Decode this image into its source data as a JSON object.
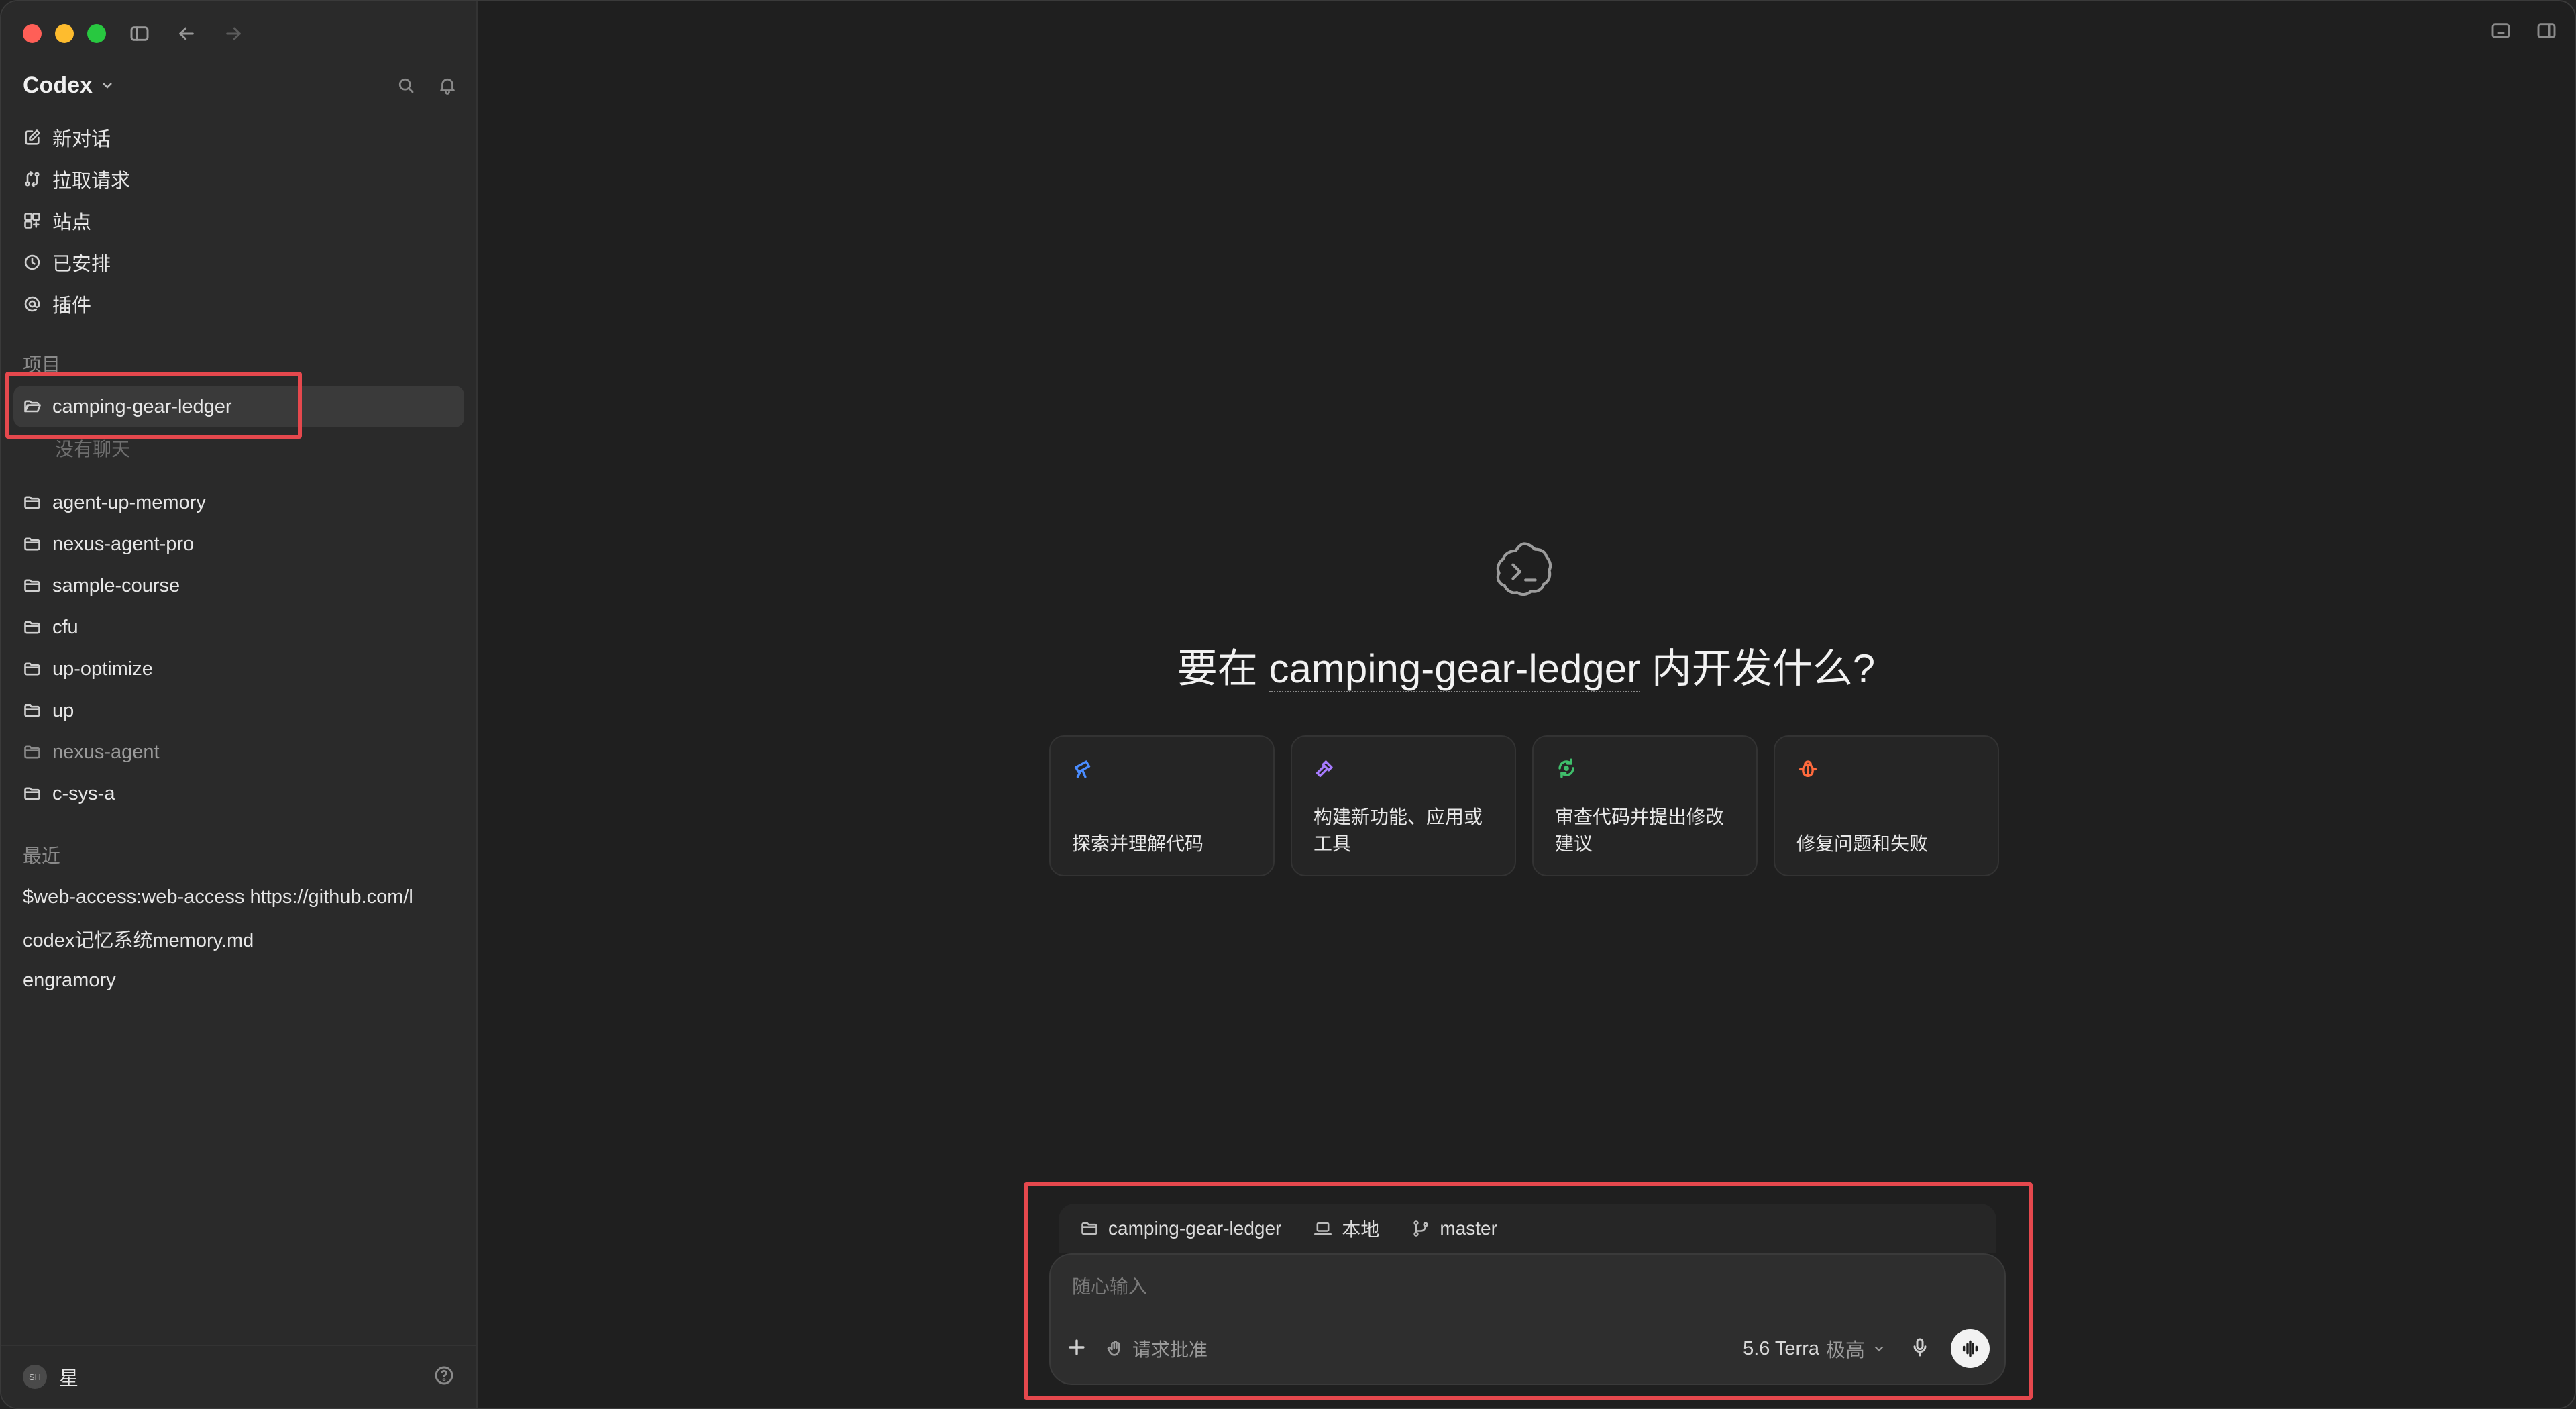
{
  "app": {
    "name": "Codex",
    "user_initials": "SH",
    "user_name": "星"
  },
  "nav": [
    {
      "label": "新对话",
      "icon": "compose-icon"
    },
    {
      "label": "拉取请求",
      "icon": "pull-request-icon"
    },
    {
      "label": "站点",
      "icon": "sites-icon"
    },
    {
      "label": "已安排",
      "icon": "clock-icon"
    },
    {
      "label": "插件",
      "icon": "at-icon"
    }
  ],
  "projects": {
    "heading": "项目",
    "active": "camping-gear-ledger",
    "empty_note": "没有聊天",
    "items": [
      "agent-up-memory",
      "nexus-agent-pro",
      "sample-course",
      "cfu",
      "up-optimize",
      "up",
      "nexus-agent",
      "c-sys-a"
    ]
  },
  "recent": {
    "heading": "最近",
    "items": [
      "$web-access:web-access https://github.com/l",
      "codex记忆系统memory.md",
      "engramory"
    ]
  },
  "main": {
    "headline_prefix": "要在 ",
    "headline_project": "camping-gear-ledger",
    "headline_suffix": " 内开发什么?",
    "cards": [
      {
        "label": "探索并理解代码",
        "icon": "telescope-icon",
        "color": "#4a8cff"
      },
      {
        "label": "构建新功能、应用或工具",
        "icon": "hammer-icon",
        "color": "#a77bff"
      },
      {
        "label": "审查代码并提出修改建议",
        "icon": "review-icon",
        "color": "#3fbf6b"
      },
      {
        "label": "修复问题和失败",
        "icon": "bug-icon",
        "color": "#ff6a3d"
      }
    ]
  },
  "composer": {
    "context_project": "camping-gear-ledger",
    "context_env": "本地",
    "context_branch": "master",
    "placeholder": "随心输入",
    "approval": "请求批准",
    "model": "5.6 Terra",
    "effort": "极高"
  },
  "colors": {
    "highlight": "#e5484d"
  }
}
